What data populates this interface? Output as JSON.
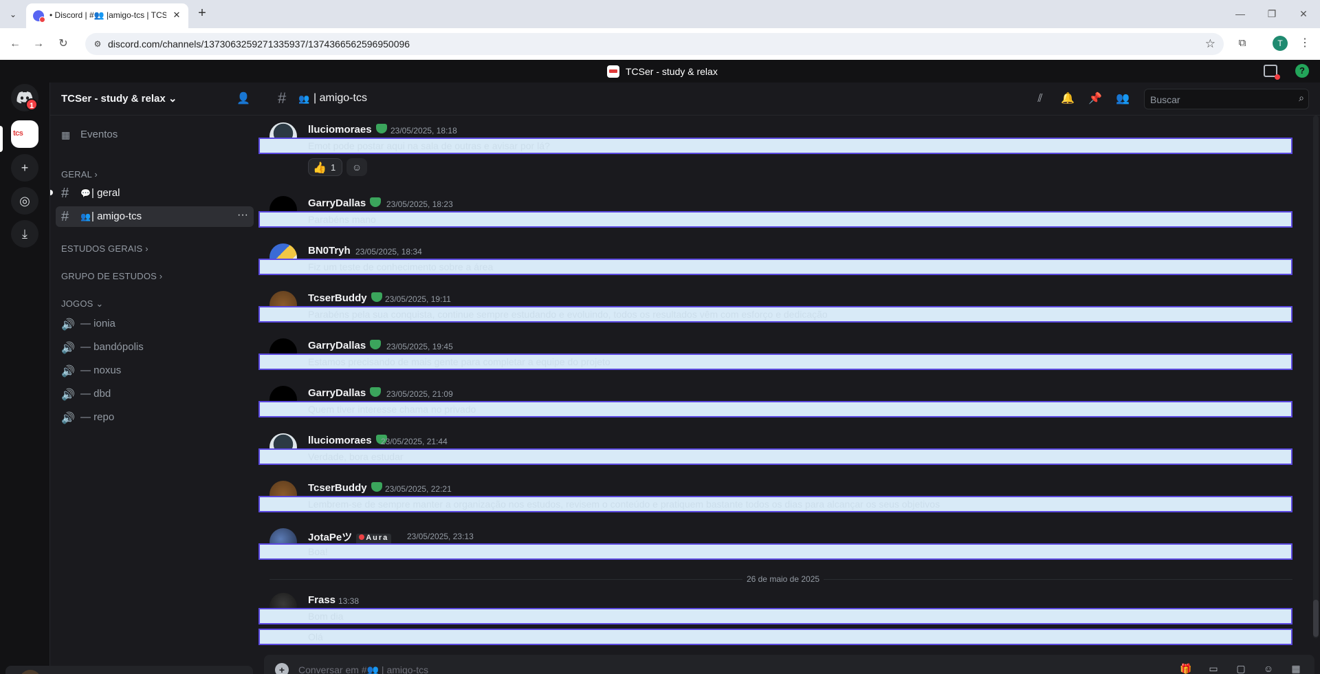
{
  "browser": {
    "tab_title": "• Discord | #👥 |amigo-tcs | TCSer",
    "url": "discord.com/channels/1373063259271335937/1374366562596950096",
    "profile_initial": "T"
  },
  "discord": {
    "window_title": "TCSer - study & relax",
    "notification_count": "1",
    "server_rail_label": "tcs"
  },
  "sidebar": {
    "server_name": "TCSer - study & relax",
    "events_label": "Eventos",
    "categories": {
      "geral": "GERAL",
      "estudos": "ESTUDOS GERAIS",
      "grupo": "GRUPO DE ESTUDOS",
      "jogos": "JOGOS"
    },
    "channels": [
      {
        "emoji": "💬",
        "label": "| geral"
      },
      {
        "emoji": "👥",
        "label": "| amigo-tcs"
      }
    ],
    "voice_channels": [
      {
        "label": "— ionia"
      },
      {
        "label": "— bandópolis"
      },
      {
        "label": "— noxus"
      },
      {
        "label": "— dbd"
      },
      {
        "label": "— repo"
      }
    ]
  },
  "chat": {
    "channel_emoji": "👥",
    "channel_name": "| amigo-tcs",
    "search_placeholder": "Buscar",
    "composer_placeholder": "Conversar em #👥 | amigo-tcs",
    "date_divider": "26 de maio de 2025",
    "messages": [
      {
        "author": "lluciomoraes",
        "time": "23/05/2025, 18:18",
        "text": "Emot pode postar aqui na sala de outras e avisar por lá?",
        "badge": true
      },
      {
        "author": "GarryDallas",
        "time": "23/05/2025, 18:23",
        "text": "Parabéns mano",
        "badge": true
      },
      {
        "author": "BN0Tryh",
        "time": "23/05/2025, 18:34",
        "text": "Fiz um teste de conhecimento sobre a área",
        "badge": false
      },
      {
        "author": "TcserBuddy",
        "time": "23/05/2025, 19:11",
        "text": "Parabéns pela sua conquista, continue sempre estudando e evoluindo, todos os resultados vêm com esforço e dedicação",
        "badge": true
      },
      {
        "author": "GarryDallas",
        "time": "23/05/2025, 19:45",
        "text": "Estamos precisando de mais gente para completar a equipe do projeto",
        "badge": true
      },
      {
        "author": "GarryDallas",
        "time": "23/05/2025, 21:09",
        "text": "Quem tiver interesse chama no privado",
        "badge": true
      },
      {
        "author": "lluciomoraes",
        "time": "23/05/2025, 21:44",
        "text": "Verdade, bora estudar",
        "badge": true
      },
      {
        "author": "TcserBuddy",
        "time": "23/05/2025, 22:21",
        "text": "Lembrem-se de sempre manter a organização nos estudos, revisem o conteúdo e pratiquem bastante todos os dias para alcançar os seus objetivos",
        "badge": true
      },
      {
        "author": "JotaPeツ",
        "time": "23/05/2025, 23:13",
        "text": "Boa!",
        "badge": false,
        "tag": "Aura"
      },
      {
        "author": "Frass",
        "time": "13:38",
        "text": "Bom dia",
        "badge": false
      },
      {
        "author": "",
        "time": "",
        "text": "Olá",
        "badge": false
      }
    ],
    "reaction": {
      "emoji": "👍",
      "count": "1"
    }
  },
  "colors": {
    "accent": "#5865f2",
    "highlight_border": "#5b49e0",
    "highlight_fill": "#d8eaf7",
    "online_green": "#23a55a",
    "badge_red": "#f23f43"
  }
}
